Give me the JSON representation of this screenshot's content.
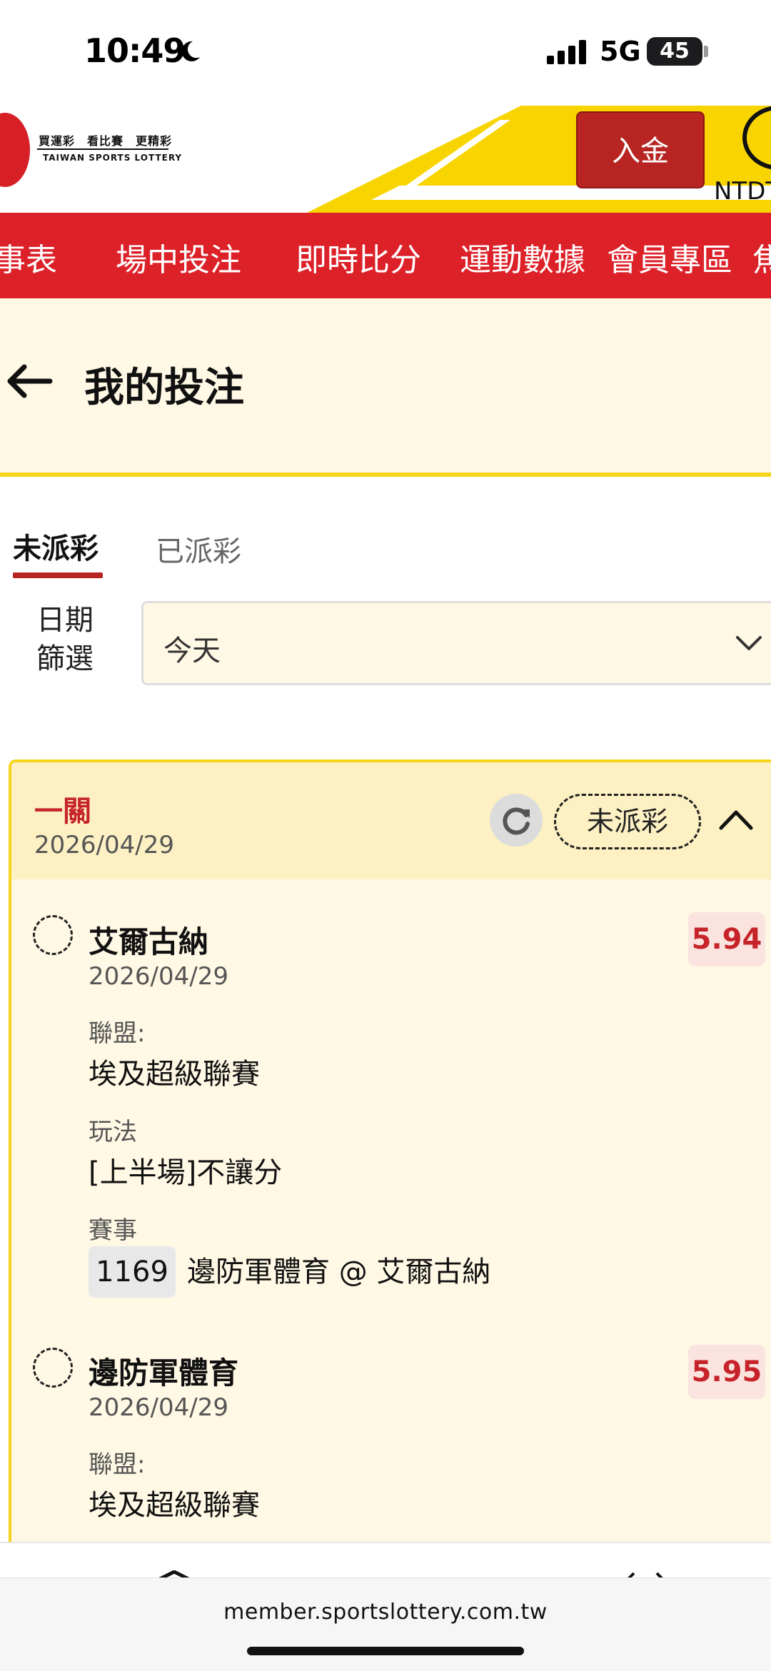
{
  "status_bar": {
    "time": "10:49",
    "network": "5G",
    "battery": "45"
  },
  "header": {
    "logo_tagline": "買運彩　看比賽　更精彩",
    "logo_name": "TAIWAN SPORTS LOTTERY",
    "deposit_label": "入金",
    "currency": "NTDT",
    "accent_color": "#f8d400",
    "brand_red": "#dd2129"
  },
  "nav": {
    "items": [
      "事表",
      "場中投注",
      "即時比分",
      "運動數據",
      "會員專區",
      "焦"
    ]
  },
  "page": {
    "title": "我的投注"
  },
  "tabs": [
    {
      "label": "未派彩",
      "active": true
    },
    {
      "label": "已派彩",
      "active": false
    }
  ],
  "filter": {
    "label": "日期篩選",
    "value": "今天"
  },
  "bet": {
    "type": "一關",
    "date": "2026/04/29",
    "status": "未派彩",
    "selections": [
      {
        "team": "艾爾古納",
        "date": "2026/04/29",
        "odds": "5.94",
        "league_label": "聯盟:",
        "league": "埃及超級聯賽",
        "play_label": "玩法",
        "play": "[上半場]不讓分",
        "match_label": "賽事",
        "match_no": "1169",
        "match": "邊防軍體育 @ 艾爾古納"
      },
      {
        "team": "邊防軍體育",
        "date": "2026/04/29",
        "odds": "5.95",
        "league_label": "聯盟:",
        "league": "埃及超級聯賽"
      }
    ]
  },
  "browser": {
    "url": "member.sportslottery.com.tw"
  }
}
